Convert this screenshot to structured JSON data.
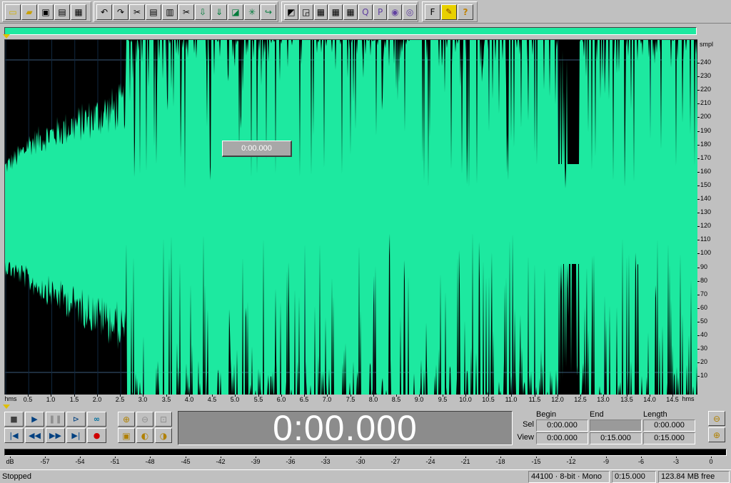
{
  "toolbar": {
    "groups": [
      [
        "new-file-icon",
        "open-file-icon",
        "save-icon",
        "save-as-icon",
        "close-file-icon"
      ],
      [
        "undo-icon",
        "redo-icon",
        "trim-icon",
        "copy-icon",
        "paste-icon",
        "cut-icon",
        "mix-paste-icon",
        "insert-icon",
        "crossfade-icon",
        "generate-icon",
        "record-icon"
      ],
      [
        "waveform-view-icon",
        "select-tool-icon",
        "grid-icon",
        "grid-icon-2",
        "grid-icon-3",
        "cd-icon",
        "preview-icon",
        "play-list-icon",
        "disc-icon"
      ],
      [
        "fx-icon",
        "wand-icon",
        "help-icon"
      ]
    ],
    "glyphs": {
      "new-file-icon": "▭",
      "open-file-icon": "▰",
      "save-icon": "▣",
      "save-as-icon": "▤",
      "close-file-icon": "▦",
      "undo-icon": "↶",
      "redo-icon": "↷",
      "trim-icon": "✂",
      "copy-icon": "▤",
      "paste-icon": "▥",
      "cut-icon": "✂",
      "mix-paste-icon": "⇩",
      "insert-icon": "⇓",
      "crossfade-icon": "◪",
      "generate-icon": "✳",
      "record-icon": "↪",
      "waveform-view-icon": "◩",
      "select-tool-icon": "◲",
      "grid-icon": "▦",
      "grid-icon-2": "▦",
      "grid-icon-3": "▦",
      "cd-icon": "Q",
      "preview-icon": "P",
      "play-list-icon": "◉",
      "disc-icon": "◎",
      "fx-icon": "F",
      "wand-icon": "✎",
      "help-icon": "?"
    }
  },
  "waveform": {
    "cursor_readout": "0:00.000",
    "color": "#1de9a0",
    "background": "#000000"
  },
  "vruler": {
    "unit": "smpl",
    "labels": [
      "240",
      "230",
      "220",
      "210",
      "200",
      "190",
      "180",
      "170",
      "160",
      "150",
      "140",
      "130",
      "120",
      "110",
      "100",
      "90",
      "80",
      "70",
      "60",
      "50",
      "40",
      "30",
      "20",
      "10"
    ]
  },
  "hruler": {
    "unit_left": "hms",
    "unit_right": "hms",
    "labels": [
      "0.5",
      "1.0",
      "1.5",
      "2.0",
      "2.5",
      "3.0",
      "3.5",
      "4.0",
      "4.5",
      "5.0",
      "5.5",
      "6.0",
      "6.5",
      "7.0",
      "7.5",
      "8.0",
      "8.5",
      "9.0",
      "9.5",
      "10.0",
      "10.5",
      "11.0",
      "11.5",
      "12.0",
      "12.5",
      "13.0",
      "13.5",
      "14.0",
      "14.5"
    ]
  },
  "transport": {
    "stop": "■",
    "play": "▶",
    "pause": "❚❚",
    "play_to_end": "⊳",
    "loop": "∞",
    "go_start": "|◀",
    "rewind": "◀◀",
    "fast_forward": "▶▶",
    "go_end": "▶|",
    "record": "●"
  },
  "zoom": {
    "zoom_in": "⊕",
    "zoom_out": "⊖",
    "zoom_full": "⊡",
    "zoom_sel": "▣",
    "zoom_left": "◐",
    "zoom_right": "◑"
  },
  "time_display": "0:00.000",
  "selection": {
    "headers": {
      "begin": "Begin",
      "end": "End",
      "length": "Length"
    },
    "sel": {
      "label": "Sel",
      "begin": "0:00.000",
      "end": "",
      "length": "0:00.000"
    },
    "view": {
      "label": "View",
      "begin": "0:00.000",
      "end": "0:15.000",
      "length": "0:15.000"
    }
  },
  "level_meter": {
    "labels": [
      "dB",
      "-57",
      "-54",
      "-51",
      "-48",
      "-45",
      "-42",
      "-39",
      "-36",
      "-33",
      "-30",
      "-27",
      "-24",
      "-21",
      "-18",
      "-15",
      "-12",
      "-9",
      "-6",
      "-3",
      "0"
    ]
  },
  "status": {
    "state": "Stopped",
    "format": "44100 · 8-bit · Mono",
    "duration": "0:15.000",
    "free": "123.84 MB free"
  }
}
